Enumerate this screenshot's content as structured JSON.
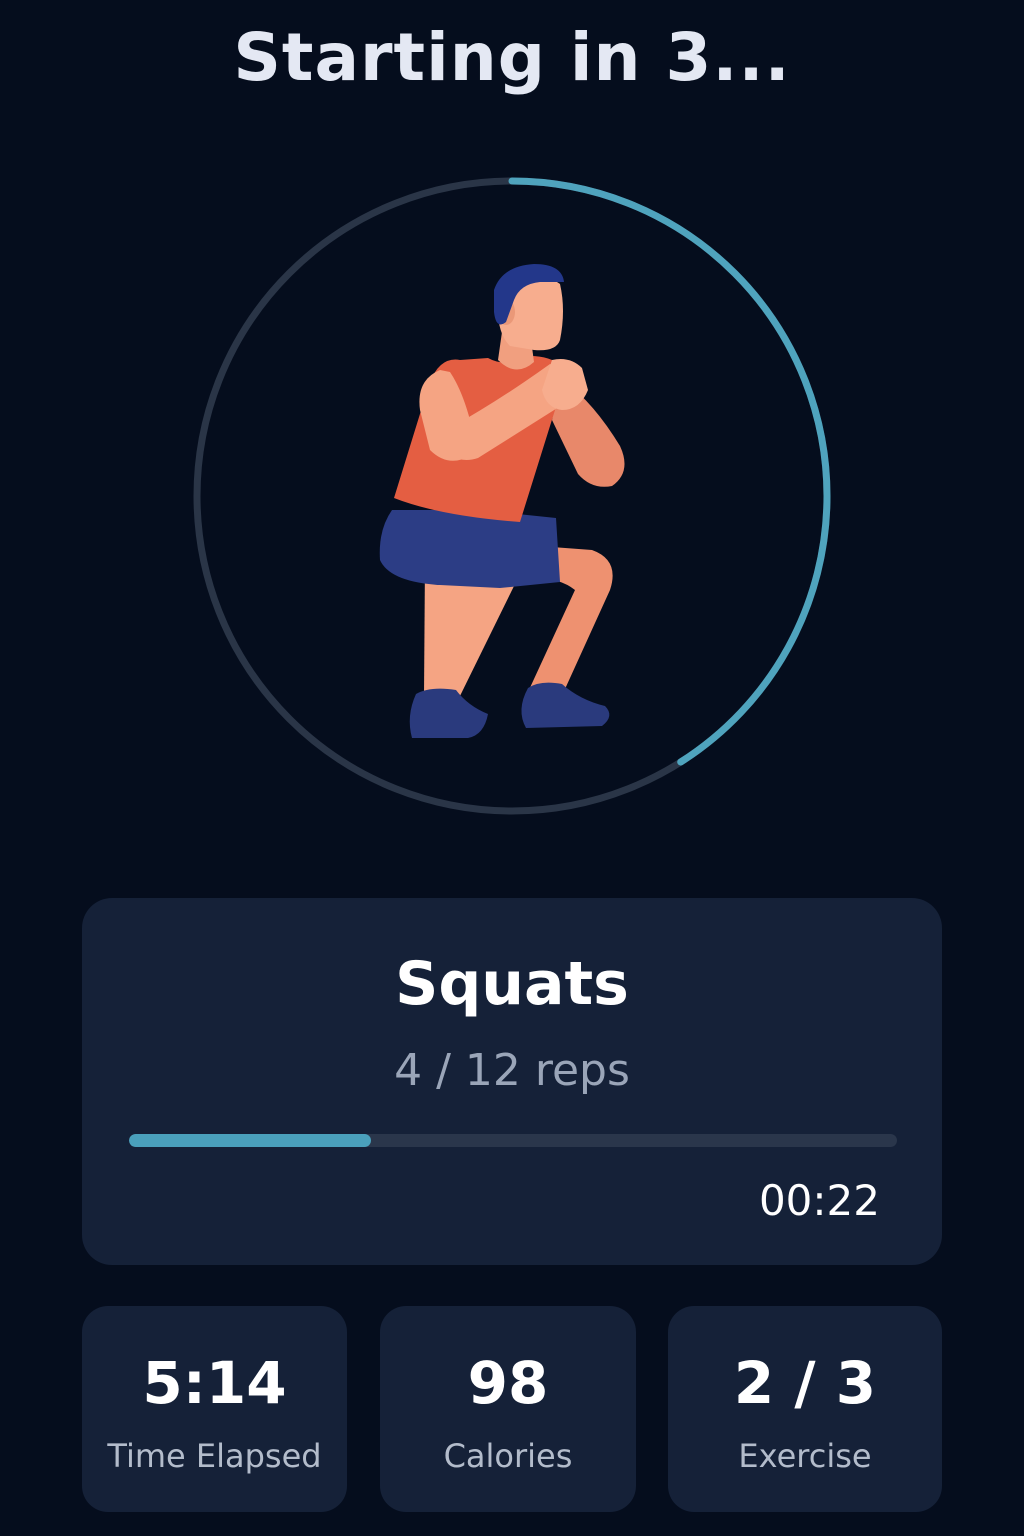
{
  "header": {
    "countdown_text": "Starting in 3..."
  },
  "ring": {
    "progress": 0.41,
    "track_color": "#2a3547",
    "fill_color": "#4fa3bd"
  },
  "illustration": {
    "icon": "squat-figure-icon"
  },
  "exercise": {
    "name": "Squats",
    "reps_text": "4 / 12 reps",
    "reps_done": 4,
    "reps_total": 12,
    "timer": "00:22"
  },
  "stats": [
    {
      "value": "5:14",
      "label": "Time Elapsed"
    },
    {
      "value": "98",
      "label": "Calories"
    },
    {
      "value": "2 / 3",
      "label": "Exercise"
    }
  ],
  "colors": {
    "background": "#050d1d",
    "card": "#152138",
    "accent": "#4aa0bc"
  }
}
